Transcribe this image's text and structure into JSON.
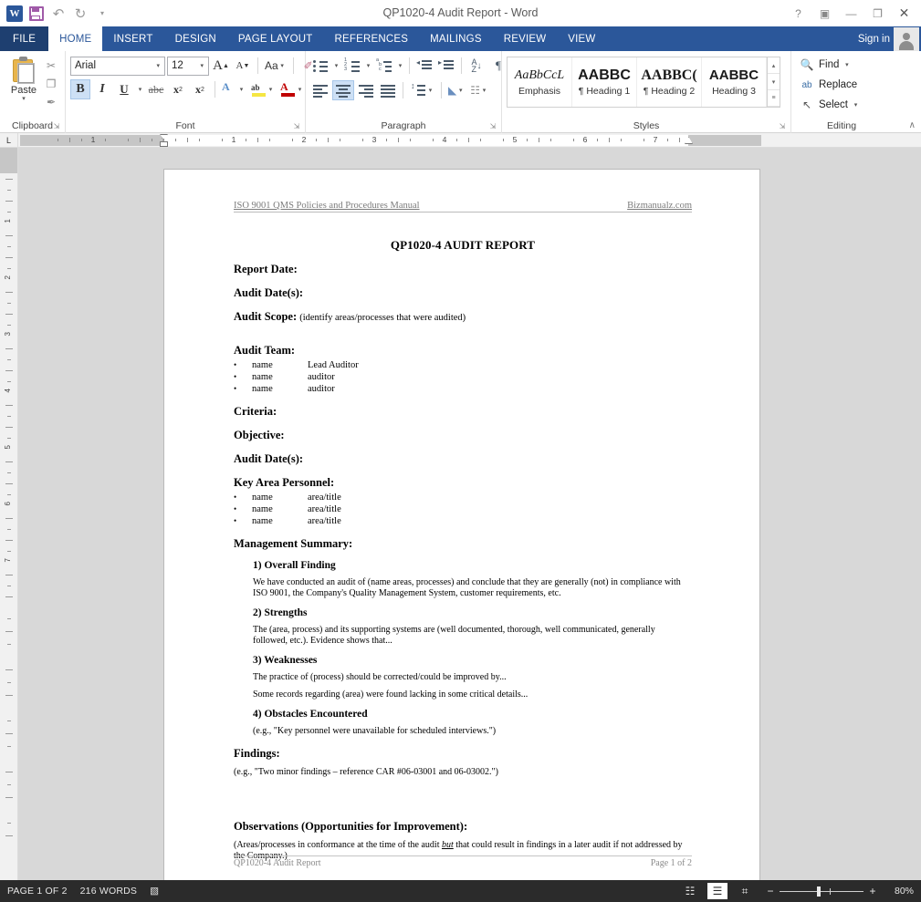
{
  "titlebar": {
    "document_title": "QP1020-4 Audit Report - Word",
    "quick_access": [
      {
        "name": "word-icon",
        "label": "W"
      },
      {
        "name": "save",
        "label": "Save"
      },
      {
        "name": "undo",
        "label": "↶"
      },
      {
        "name": "redo",
        "label": "↻"
      },
      {
        "name": "customize",
        "label": "▾"
      }
    ],
    "help_label": "?",
    "ribbon_display_label": "▣",
    "minimize_label": "—",
    "restore_label": "❐",
    "close_label": "✕"
  },
  "tabs": {
    "file_label": "FILE",
    "items": [
      {
        "label": "HOME",
        "active": true
      },
      {
        "label": "INSERT",
        "active": false
      },
      {
        "label": "DESIGN",
        "active": false
      },
      {
        "label": "PAGE LAYOUT",
        "active": false
      },
      {
        "label": "REFERENCES",
        "active": false
      },
      {
        "label": "MAILINGS",
        "active": false
      },
      {
        "label": "REVIEW",
        "active": false
      },
      {
        "label": "VIEW",
        "active": false
      }
    ],
    "signin_label": "Sign in"
  },
  "ribbon": {
    "clipboard": {
      "group_label": "Clipboard",
      "paste_label": "Paste",
      "paste_arrow": "▾",
      "cut_label": "✂",
      "copy_label": "❐",
      "format_painter_label": "✒"
    },
    "font": {
      "group_label": "Font",
      "font_name": "Arial",
      "font_size": "12",
      "grow_font_label": "A",
      "shrink_font_label": "A",
      "change_case_label": "Aa",
      "clear_formatting_label": "✐",
      "bold_label": "B",
      "italic_label": "I",
      "underline_label": "U",
      "strikethrough_label": "abc",
      "subscript_label": "x",
      "superscript_label": "x",
      "text_effects_label": "A",
      "highlight_label": "ab",
      "font_color_label": "A",
      "bold_active": true
    },
    "paragraph": {
      "group_label": "Paragraph",
      "bullets_label": "Bullets",
      "numbering_label": "Numbering",
      "multilevel_label": "Multilevel List",
      "decrease_indent_label": "Decrease Indent",
      "increase_indent_label": "Increase Indent",
      "sort_label": "Sort",
      "show_marks_label": "¶",
      "align_left_label": "Align Left",
      "align_center_label": "Center",
      "align_right_label": "Align Right",
      "justify_label": "Justify",
      "line_spacing_label": "Line Spacing",
      "shading_label": "Shading",
      "borders_label": "Borders",
      "center_active": true
    },
    "styles": {
      "group_label": "Styles",
      "items": [
        {
          "preview": "AaBbCcL",
          "name": "Emphasis"
        },
        {
          "preview": "AABBC",
          "name": "¶ Heading 1"
        },
        {
          "preview": "AABBC(",
          "name": "¶ Heading 2"
        },
        {
          "preview": "AABBC",
          "name": "Heading 3"
        }
      ],
      "scroll_up": "▴",
      "scroll_down": "▾",
      "more": "≡"
    },
    "editing": {
      "group_label": "Editing",
      "find_label": "Find",
      "replace_label": "Replace",
      "select_label": "Select",
      "find_icon": "🔍",
      "replace_icon": "ab",
      "select_icon": "↖",
      "caret": "▾"
    },
    "collapse_label": "∧",
    "launcher_label": "⤵"
  },
  "ruler": {
    "tab_selector_label": "L",
    "marks": [
      "1",
      "2",
      "3",
      "4",
      "5",
      "6",
      "7"
    ],
    "vertical_marks": [
      "1",
      "2",
      "3",
      "4",
      "5"
    ]
  },
  "document": {
    "header_left": "ISO 9001 QMS Policies and Procedures Manual",
    "header_right": "Bizmanualz.com",
    "title": "QP1020-4 AUDIT REPORT",
    "report_date_label": "Report Date:",
    "audit_dates_label": "Audit Date(s):",
    "audit_scope_label": "Audit Scope:",
    "audit_scope_note": "(identify areas/processes that were audited)",
    "audit_team_label": "Audit Team:",
    "audit_team": [
      {
        "name": "name",
        "role": "Lead Auditor"
      },
      {
        "name": "name",
        "role": "auditor"
      },
      {
        "name": "name",
        "role": "auditor"
      }
    ],
    "criteria_label": "Criteria:",
    "objective_label": "Objective:",
    "audit_dates_label2": "Audit Date(s):",
    "key_area_label": "Key Area Personnel:",
    "key_area_personnel": [
      {
        "name": "name",
        "role": "area/title"
      },
      {
        "name": "name",
        "role": "area/title"
      },
      {
        "name": "name",
        "role": "area/title"
      }
    ],
    "management_summary_label": "Management Summary:",
    "sections": [
      {
        "heading": "1) Overall Finding",
        "paragraphs": [
          "We have conducted an audit of (name areas, processes) and conclude that they are generally (not) in compliance with ISO 9001, the Company's Quality Management System, customer requirements, etc."
        ]
      },
      {
        "heading": "2) Strengths",
        "paragraphs": [
          "The (area, process) and its supporting systems are (well documented, thorough, well communicated, generally followed, etc.).  Evidence shows that..."
        ]
      },
      {
        "heading": "3) Weaknesses",
        "paragraphs": [
          "The practice of (process) should be corrected/could be improved by...",
          "Some records regarding (area) were found lacking in some critical details..."
        ]
      },
      {
        "heading": "4) Obstacles Encountered",
        "paragraphs": [
          "(e.g., \"Key personnel were unavailable for scheduled interviews.\")"
        ]
      }
    ],
    "findings_label": "Findings:",
    "findings_text": "(e.g., \"Two minor findings – reference CAR #06-03001 and 06-03002.\")",
    "observations_label": "Observations (Opportunities for Improvement):",
    "observations_pre": "(Areas/processes in conformance at the time of the audit ",
    "observations_emphasis": "but",
    "observations_post": " that could result in findings in a later audit if not addressed by the Company.)",
    "footer_left": "QP1020-4 Audit Report",
    "footer_right": "Page 1 of 2"
  },
  "statusbar": {
    "page_label": "PAGE 1 OF 2",
    "word_count": "216 WORDS",
    "proofing_icon": "▧",
    "read_mode_label": "☷",
    "print_layout_label": "☰",
    "web_layout_label": "⌗",
    "zoom_out": "−",
    "zoom_in": "+",
    "zoom_level": "80%"
  }
}
